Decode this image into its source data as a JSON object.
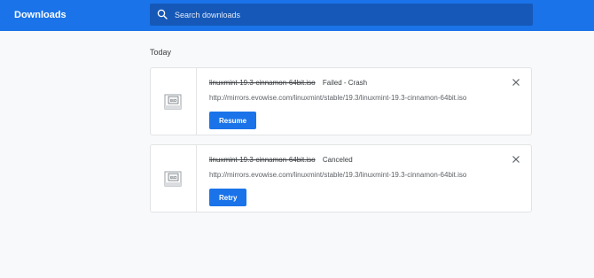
{
  "header": {
    "title": "Downloads",
    "accent_color": "#1a73e8"
  },
  "search": {
    "placeholder": "Search downloads",
    "value": "",
    "icon": "search-icon"
  },
  "section": {
    "heading": "Today"
  },
  "downloads": [
    {
      "file_name": "linuxmint-19.3-cinnamon-64bit.iso",
      "status": "Failed - Crash",
      "url": "http://mirrors.evowise.com/linuxmint/stable/19.3/linuxmint-19.3-cinnamon-64bit.iso",
      "action_label": "Resume",
      "file_icon": "iso-file-icon",
      "file_icon_text": "ISO",
      "close_icon": "close-icon"
    },
    {
      "file_name": "linuxmint-19.3-cinnamon-64bit.iso",
      "status": "Canceled",
      "url": "http://mirrors.evowise.com/linuxmint/stable/19.3/linuxmint-19.3-cinnamon-64bit.iso",
      "action_label": "Retry",
      "file_icon": "iso-file-icon",
      "file_icon_text": "ISO",
      "close_icon": "close-icon"
    }
  ]
}
